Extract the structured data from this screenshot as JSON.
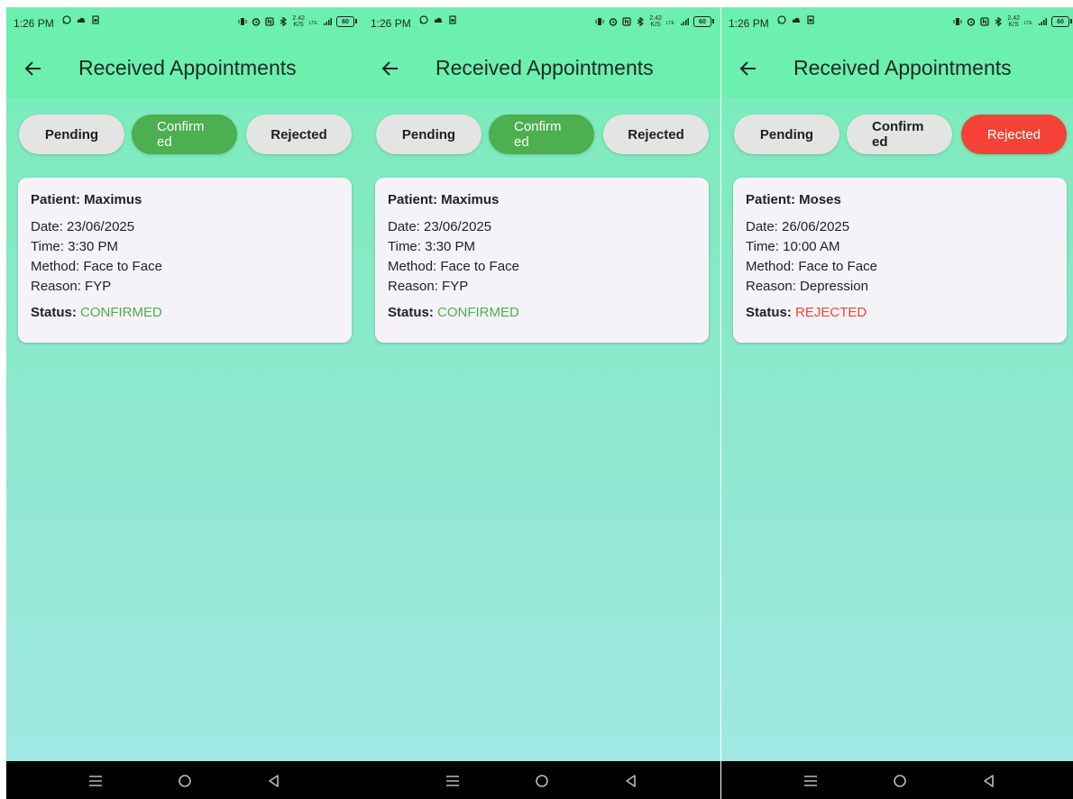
{
  "screens": [
    {
      "status": {
        "time": "1:26 PM",
        "battery": "60",
        "net_speed": "2.42",
        "net_unit": "K/S"
      },
      "title": "Received Appointments",
      "tabs": {
        "pending": "Pending",
        "confirmed": "Confirm\ned",
        "rejected": "Rejected"
      },
      "active_tab": "confirmed",
      "card": {
        "patient": "Patient: Maximus",
        "date": "Date: 23/06/2025",
        "time": "Time: 3:30 PM",
        "method": "Method: Face to Face",
        "reason": "Reason: FYP",
        "status_label": "Status:",
        "status_value": "CONFIRMED"
      }
    },
    {
      "status": {
        "time": "1:26 PM",
        "battery": "60",
        "net_speed": "2.42",
        "net_unit": "K/S"
      },
      "title": "Received Appointments",
      "tabs": {
        "pending": "Pending",
        "confirmed": "Confirm\ned",
        "rejected": "Rejected"
      },
      "active_tab": "confirmed",
      "card": {
        "patient": "Patient: Maximus",
        "date": "Date: 23/06/2025",
        "time": "Time: 3:30 PM",
        "method": "Method: Face to Face",
        "reason": "Reason: FYP",
        "status_label": "Status:",
        "status_value": "CONFIRMED"
      }
    },
    {
      "status": {
        "time": "1:26 PM",
        "battery": "60",
        "net_speed": "2.42",
        "net_unit": "K/S"
      },
      "title": "Received Appointments",
      "tabs": {
        "pending": "Pending",
        "confirmed": "Confirm\ned",
        "rejected": "Rejected"
      },
      "active_tab": "rejected",
      "card": {
        "patient": "Patient: Moses",
        "date": "Date: 26/06/2025",
        "time": "Time: 10:00 AM",
        "method": "Method: Face to Face",
        "reason": "Reason: Depression",
        "status_label": "Status:",
        "status_value": "REJECTED"
      }
    }
  ],
  "colors": {
    "appbar": "#6cf0ad",
    "confirmed": "#4caf50",
    "rejected": "#f44336",
    "chip_inactive": "#e4e4e4",
    "card": "#f6f3f8"
  },
  "icons": {
    "status_left": [
      "whatsapp-icon",
      "cloud-icon",
      "sim-card-icon"
    ],
    "status_right": [
      "vibrate-icon",
      "alarm-icon",
      "nfc-icon",
      "bluetooth-icon",
      "lte-icon",
      "signal-icon",
      "battery-icon"
    ],
    "nav": [
      "recent-apps-icon",
      "home-icon",
      "back-triangle-icon"
    ]
  }
}
